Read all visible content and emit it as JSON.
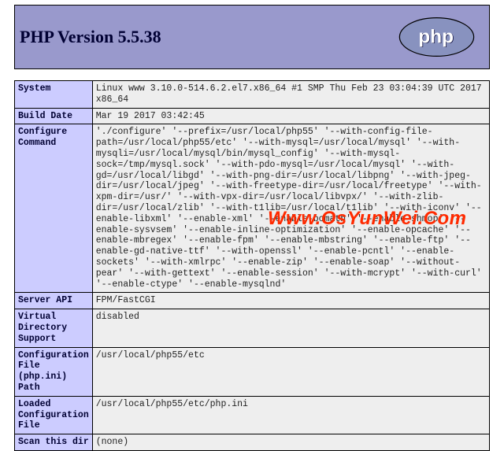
{
  "header": {
    "title": "PHP Version 5.5.38",
    "logo_text": "php"
  },
  "rows": [
    {
      "label": "System",
      "value": "Linux www 3.10.0-514.6.2.el7.x86_64 #1 SMP Thu Feb 23 03:04:39 UTC 2017 x86_64"
    },
    {
      "label": "Build Date",
      "value": "Mar 19 2017 03:42:45"
    },
    {
      "label": "Configure Command",
      "value": "'./configure' '--prefix=/usr/local/php55' '--with-config-file-path=/usr/local/php55/etc' '--with-mysql=/usr/local/mysql' '--with-mysqli=/usr/local/mysql/bin/mysql_config' '--with-mysql-sock=/tmp/mysql.sock' '--with-pdo-mysql=/usr/local/mysql' '--with-gd=/usr/local/libgd' '--with-png-dir=/usr/local/libpng' '--with-jpeg-dir=/usr/local/jpeg' '--with-freetype-dir=/usr/local/freetype' '--with-xpm-dir=/usr/' '--with-vpx-dir=/usr/local/libvpx/' '--with-zlib-dir=/usr/local/zlib' '--with-t1lib=/usr/local/t1lib' '--with-iconv' '--enable-libxml' '--enable-xml' '--enable-bcmath' '--enable-shmop' '--enable-sysvsem' '--enable-inline-optimization' '--enable-opcache' '--enable-mbregex' '--enable-fpm' '--enable-mbstring' '--enable-ftp' '--enable-gd-native-ttf' '--with-openssl' '--enable-pcntl' '--enable-sockets' '--with-xmlrpc' '--enable-zip' '--enable-soap' '--without-pear' '--with-gettext' '--enable-session' '--with-mcrypt' '--with-curl' '--enable-ctype' '--enable-mysqlnd'"
    },
    {
      "label": "Server API",
      "value": "FPM/FastCGI"
    },
    {
      "label": "Virtual Directory Support",
      "value": "disabled"
    },
    {
      "label": "Configuration File (php.ini) Path",
      "value": "/usr/local/php55/etc"
    },
    {
      "label": "Loaded Configuration File",
      "value": "/usr/local/php55/etc/php.ini"
    },
    {
      "label": "Scan this dir",
      "value": "(none)"
    }
  ],
  "watermark": "Www.OsYunWei.Com"
}
